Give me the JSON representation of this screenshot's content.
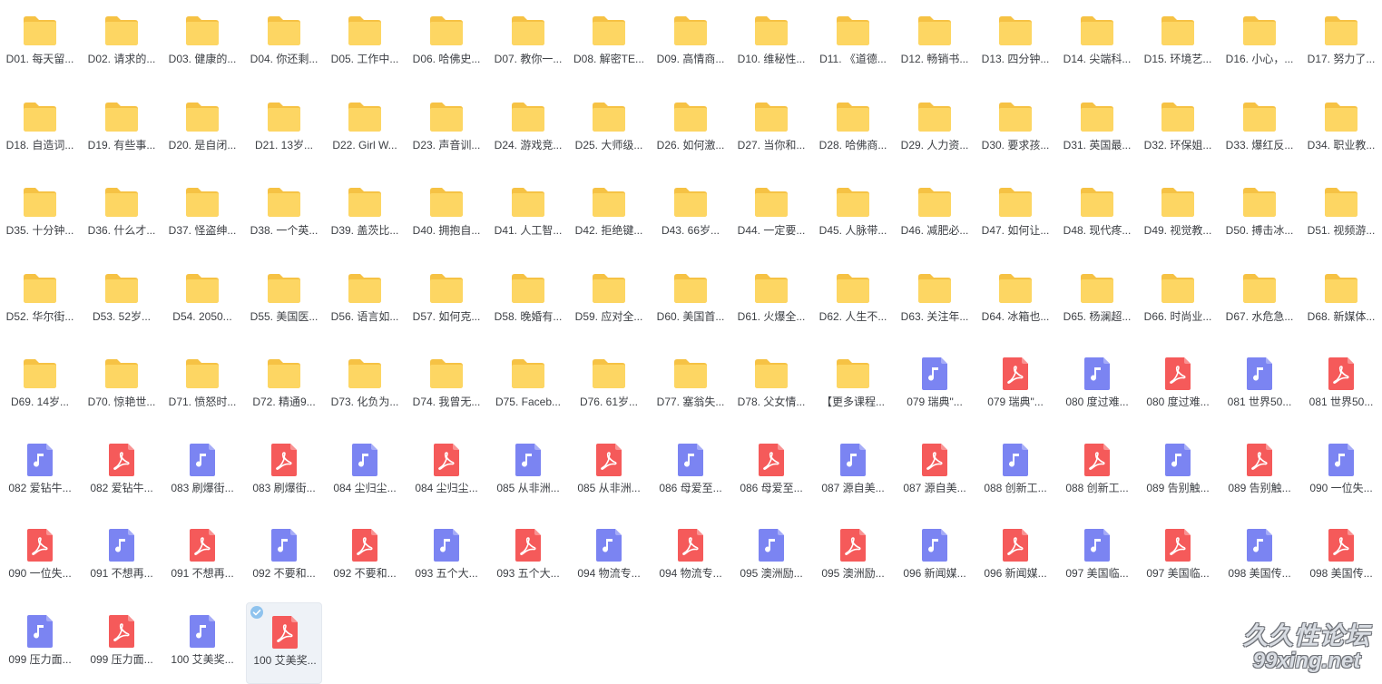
{
  "colors": {
    "folder": "#fdd663",
    "folder_tab": "#f6c244",
    "audio": "#7b84f2",
    "pdf": "#f55a5a",
    "label_text": "#3c3f44",
    "selected_bg": "#eef2f7"
  },
  "files": [
    {
      "label": "D01. 每天留...",
      "icon": "folder-icon"
    },
    {
      "label": "D02. 请求的...",
      "icon": "folder-icon"
    },
    {
      "label": "D03. 健康的...",
      "icon": "folder-icon"
    },
    {
      "label": "D04. 你还剩...",
      "icon": "folder-icon"
    },
    {
      "label": "D05. 工作中...",
      "icon": "folder-icon"
    },
    {
      "label": "D06. 哈佛史...",
      "icon": "folder-icon"
    },
    {
      "label": "D07. 教你一...",
      "icon": "folder-icon"
    },
    {
      "label": "D08. 解密TE...",
      "icon": "folder-icon"
    },
    {
      "label": "D09. 高情商...",
      "icon": "folder-icon"
    },
    {
      "label": "D10. 维秘性...",
      "icon": "folder-icon"
    },
    {
      "label": "D11. 《道德...",
      "icon": "folder-icon"
    },
    {
      "label": "D12. 畅销书...",
      "icon": "folder-icon"
    },
    {
      "label": "D13. 四分钟...",
      "icon": "folder-icon"
    },
    {
      "label": "D14. 尖端科...",
      "icon": "folder-icon"
    },
    {
      "label": "D15. 环境艺...",
      "icon": "folder-icon"
    },
    {
      "label": "D16. 小心，...",
      "icon": "folder-icon"
    },
    {
      "label": "D17. 努力了...",
      "icon": "folder-icon"
    },
    {
      "label": "D18. 自造词...",
      "icon": "folder-icon"
    },
    {
      "label": "D19. 有些事...",
      "icon": "folder-icon"
    },
    {
      "label": "D20. 是自闭...",
      "icon": "folder-icon"
    },
    {
      "label": "D21. 13岁...",
      "icon": "folder-icon"
    },
    {
      "label": "D22. Girl W...",
      "icon": "folder-icon"
    },
    {
      "label": "D23. 声音训...",
      "icon": "folder-icon"
    },
    {
      "label": "D24. 游戏竞...",
      "icon": "folder-icon"
    },
    {
      "label": "D25. 大师级...",
      "icon": "folder-icon"
    },
    {
      "label": "D26. 如何激...",
      "icon": "folder-icon"
    },
    {
      "label": "D27. 当你和...",
      "icon": "folder-icon"
    },
    {
      "label": "D28. 哈佛商...",
      "icon": "folder-icon"
    },
    {
      "label": "D29. 人力资...",
      "icon": "folder-icon"
    },
    {
      "label": "D30. 要求孩...",
      "icon": "folder-icon"
    },
    {
      "label": "D31. 英国最...",
      "icon": "folder-icon"
    },
    {
      "label": "D32. 环保姐...",
      "icon": "folder-icon"
    },
    {
      "label": "D33. 爆红反...",
      "icon": "folder-icon"
    },
    {
      "label": "D34. 职业教...",
      "icon": "folder-icon"
    },
    {
      "label": "D35. 十分钟...",
      "icon": "folder-icon"
    },
    {
      "label": "D36. 什么才...",
      "icon": "folder-icon"
    },
    {
      "label": "D37. 怪盗绅...",
      "icon": "folder-icon"
    },
    {
      "label": "D38. 一个英...",
      "icon": "folder-icon"
    },
    {
      "label": "D39. 盖茨比...",
      "icon": "folder-icon"
    },
    {
      "label": "D40. 拥抱自...",
      "icon": "folder-icon"
    },
    {
      "label": "D41. 人工智...",
      "icon": "folder-icon"
    },
    {
      "label": "D42. 拒绝键...",
      "icon": "folder-icon"
    },
    {
      "label": "D43. 66岁...",
      "icon": "folder-icon"
    },
    {
      "label": "D44. 一定要...",
      "icon": "folder-icon"
    },
    {
      "label": "D45. 人脉带...",
      "icon": "folder-icon"
    },
    {
      "label": "D46. 减肥必...",
      "icon": "folder-icon"
    },
    {
      "label": "D47. 如何让...",
      "icon": "folder-icon"
    },
    {
      "label": "D48. 现代疼...",
      "icon": "folder-icon"
    },
    {
      "label": "D49. 视觉教...",
      "icon": "folder-icon"
    },
    {
      "label": "D50. 搏击冰...",
      "icon": "folder-icon"
    },
    {
      "label": "D51. 视频游...",
      "icon": "folder-icon"
    },
    {
      "label": "D52. 华尔街...",
      "icon": "folder-icon"
    },
    {
      "label": "D53. 52岁...",
      "icon": "folder-icon"
    },
    {
      "label": "D54. 2050...",
      "icon": "folder-icon"
    },
    {
      "label": "D55. 美国医...",
      "icon": "folder-icon"
    },
    {
      "label": "D56. 语言如...",
      "icon": "folder-icon"
    },
    {
      "label": "D57. 如何克...",
      "icon": "folder-icon"
    },
    {
      "label": "D58. 晚婚有...",
      "icon": "folder-icon"
    },
    {
      "label": "D59. 应对全...",
      "icon": "folder-icon"
    },
    {
      "label": "D60. 美国首...",
      "icon": "folder-icon"
    },
    {
      "label": "D61. 火爆全...",
      "icon": "folder-icon"
    },
    {
      "label": "D62. 人生不...",
      "icon": "folder-icon"
    },
    {
      "label": "D63. 关注年...",
      "icon": "folder-icon"
    },
    {
      "label": "D64. 冰箱也...",
      "icon": "folder-icon"
    },
    {
      "label": "D65. 杨澜超...",
      "icon": "folder-icon"
    },
    {
      "label": "D66. 时尚业...",
      "icon": "folder-icon"
    },
    {
      "label": "D67. 水危急...",
      "icon": "folder-icon"
    },
    {
      "label": "D68. 新媒体...",
      "icon": "folder-icon"
    },
    {
      "label": "D69. 14岁...",
      "icon": "folder-icon"
    },
    {
      "label": "D70. 惊艳世...",
      "icon": "folder-icon"
    },
    {
      "label": "D71. 愤怒时...",
      "icon": "folder-icon"
    },
    {
      "label": "D72. 精通9...",
      "icon": "folder-icon"
    },
    {
      "label": "D73. 化负为...",
      "icon": "folder-icon"
    },
    {
      "label": "D74. 我曾无...",
      "icon": "folder-icon"
    },
    {
      "label": "D75. Faceb...",
      "icon": "folder-icon"
    },
    {
      "label": "D76. 61岁...",
      "icon": "folder-icon"
    },
    {
      "label": "D77. 塞翁失...",
      "icon": "folder-icon"
    },
    {
      "label": "D78. 父女情...",
      "icon": "folder-icon"
    },
    {
      "label": "【更多课程...",
      "icon": "folder-icon"
    },
    {
      "label": "079 瑞典\"...",
      "icon": "audio-file-icon"
    },
    {
      "label": "079 瑞典\"...",
      "icon": "pdf-file-icon"
    },
    {
      "label": "080 度过难...",
      "icon": "audio-file-icon"
    },
    {
      "label": "080 度过难...",
      "icon": "pdf-file-icon"
    },
    {
      "label": "081 世界50...",
      "icon": "audio-file-icon"
    },
    {
      "label": "081 世界50...",
      "icon": "pdf-file-icon"
    },
    {
      "label": "082 爱钻牛...",
      "icon": "audio-file-icon"
    },
    {
      "label": "082 爱钻牛...",
      "icon": "pdf-file-icon"
    },
    {
      "label": "083 刷爆街...",
      "icon": "audio-file-icon"
    },
    {
      "label": "083 刷爆街...",
      "icon": "pdf-file-icon"
    },
    {
      "label": "084 尘归尘...",
      "icon": "audio-file-icon"
    },
    {
      "label": "084 尘归尘...",
      "icon": "pdf-file-icon"
    },
    {
      "label": "085 从非洲...",
      "icon": "audio-file-icon"
    },
    {
      "label": "085 从非洲...",
      "icon": "pdf-file-icon"
    },
    {
      "label": "086 母爱至...",
      "icon": "audio-file-icon"
    },
    {
      "label": "086 母爱至...",
      "icon": "pdf-file-icon"
    },
    {
      "label": "087 源自美...",
      "icon": "audio-file-icon"
    },
    {
      "label": "087 源自美...",
      "icon": "pdf-file-icon"
    },
    {
      "label": "088 创新工...",
      "icon": "audio-file-icon"
    },
    {
      "label": "088 创新工...",
      "icon": "pdf-file-icon"
    },
    {
      "label": "089 告别触...",
      "icon": "audio-file-icon"
    },
    {
      "label": "089 告别触...",
      "icon": "pdf-file-icon"
    },
    {
      "label": "090 一位失...",
      "icon": "audio-file-icon"
    },
    {
      "label": "090 一位失...",
      "icon": "pdf-file-icon"
    },
    {
      "label": "091 不想再...",
      "icon": "audio-file-icon"
    },
    {
      "label": "091 不想再...",
      "icon": "pdf-file-icon"
    },
    {
      "label": "092 不要和...",
      "icon": "audio-file-icon"
    },
    {
      "label": "092 不要和...",
      "icon": "pdf-file-icon"
    },
    {
      "label": "093 五个大...",
      "icon": "audio-file-icon"
    },
    {
      "label": "093 五个大...",
      "icon": "pdf-file-icon"
    },
    {
      "label": "094 物流专...",
      "icon": "audio-file-icon"
    },
    {
      "label": "094 物流专...",
      "icon": "pdf-file-icon"
    },
    {
      "label": "095 澳洲励...",
      "icon": "audio-file-icon"
    },
    {
      "label": "095 澳洲励...",
      "icon": "pdf-file-icon"
    },
    {
      "label": "096 新闻媒...",
      "icon": "audio-file-icon"
    },
    {
      "label": "096 新闻媒...",
      "icon": "pdf-file-icon"
    },
    {
      "label": "097 美国临...",
      "icon": "audio-file-icon"
    },
    {
      "label": "097 美国临...",
      "icon": "pdf-file-icon"
    },
    {
      "label": "098 美国传...",
      "icon": "audio-file-icon"
    },
    {
      "label": "098 美国传...",
      "icon": "pdf-file-icon"
    },
    {
      "label": "099 压力面...",
      "icon": "audio-file-icon"
    },
    {
      "label": "099 压力面...",
      "icon": "pdf-file-icon"
    },
    {
      "label": "100 艾美奖...",
      "icon": "audio-file-icon"
    },
    {
      "label": "100 艾美奖...",
      "icon": "pdf-file-icon",
      "selected": true
    }
  ],
  "watermark": {
    "line1": "久久性论坛",
    "line2": "99xing.net"
  }
}
